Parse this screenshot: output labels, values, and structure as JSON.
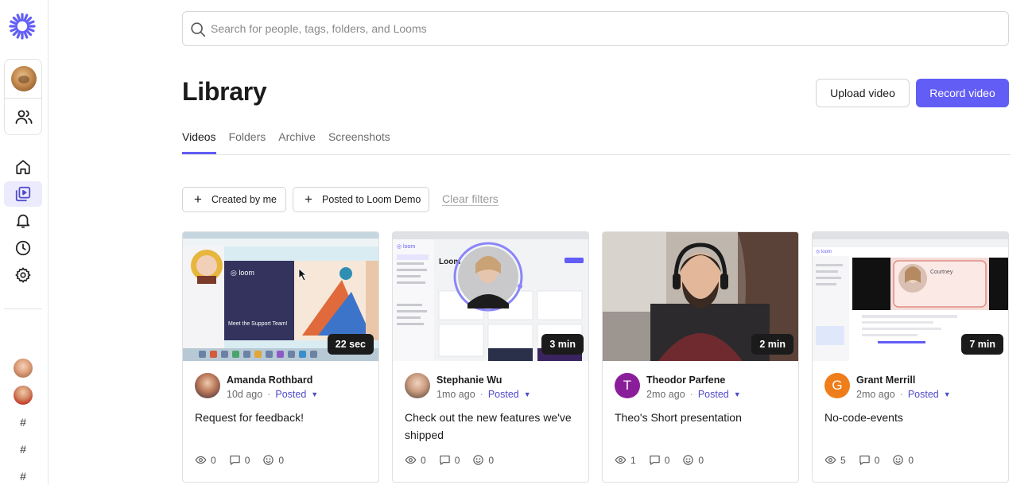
{
  "search": {
    "placeholder": "Search for people, tags, folders, and Looms"
  },
  "header": {
    "title": "Library",
    "upload_label": "Upload video",
    "record_label": "Record video"
  },
  "tabs": [
    {
      "label": "Videos",
      "active": true
    },
    {
      "label": "Folders"
    },
    {
      "label": "Archive"
    },
    {
      "label": "Screenshots"
    }
  ],
  "filters": {
    "created_by_me": "Created by me",
    "posted_to": "Posted to Loom Demo",
    "clear": "Clear filters"
  },
  "sidebar": {
    "channels": [
      "#",
      "#",
      "#"
    ]
  },
  "accent": "#625df5",
  "videos": [
    {
      "duration": "22 sec",
      "author": "Amanda Rothbard",
      "ago": "10d ago",
      "status": "Posted",
      "title": "Request for feedback!",
      "views": "0",
      "comments": "0",
      "reactions": "0",
      "thumb_caption": "Meet the Support Team!"
    },
    {
      "duration": "3 min",
      "author": "Stephanie Wu",
      "ago": "1mo ago",
      "status": "Posted",
      "title": "Check out the new features we've shipped",
      "views": "0",
      "comments": "0",
      "reactions": "0"
    },
    {
      "duration": "2 min",
      "author": "Theodor Parfene",
      "initial": "T",
      "ago": "2mo ago",
      "status": "Posted",
      "title": "Theo's Short presentation",
      "views": "1",
      "comments": "0",
      "reactions": "0"
    },
    {
      "duration": "7 min",
      "author": "Grant Merrill",
      "initial": "G",
      "ago": "2mo ago",
      "status": "Posted",
      "title": "No-code-events",
      "views": "5",
      "comments": "0",
      "reactions": "0"
    }
  ]
}
